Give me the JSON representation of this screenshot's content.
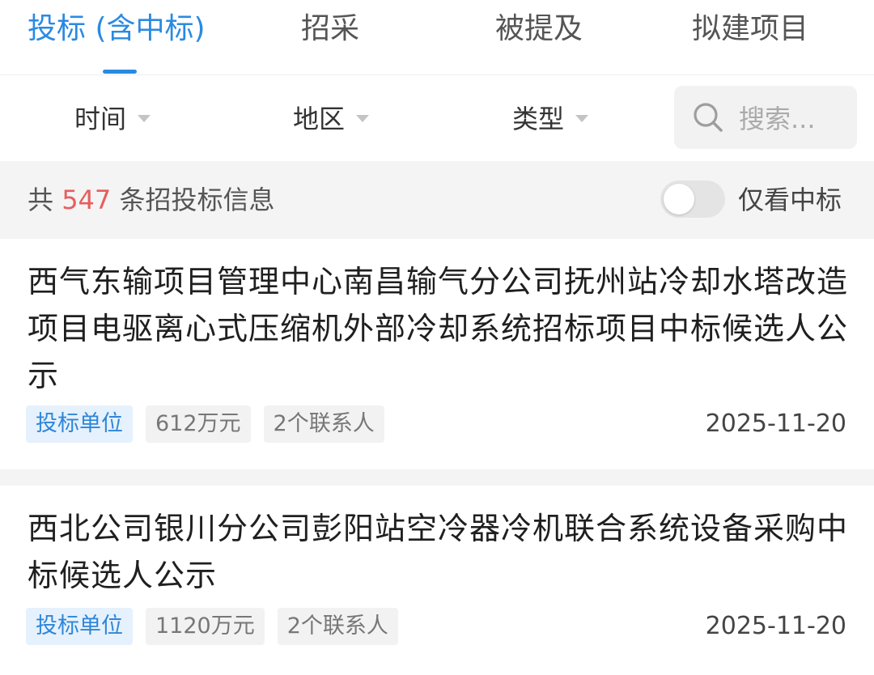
{
  "tabs": [
    {
      "label": "投标 (含中标)",
      "active": true
    },
    {
      "label": "招采",
      "active": false
    },
    {
      "label": "被提及",
      "active": false
    },
    {
      "label": "拟建项目",
      "active": false
    }
  ],
  "filters": {
    "time": "时间",
    "region": "地区",
    "type": "类型",
    "search_placeholder": "搜索..."
  },
  "summary": {
    "prefix": "共",
    "count": "547",
    "suffix": "条招投标信息",
    "toggle_label": "仅看中标",
    "toggle_on": false
  },
  "items": [
    {
      "title": "西气东输项目管理中心南昌输气分公司抚州站冷却水塔改造项目电驱离心式压缩机外部冷却系统招标项目中标候选人公示",
      "tag_role": "投标单位",
      "amount": "612万元",
      "contacts": "2个联系人",
      "date": "2025-11-20"
    },
    {
      "title": "西北公司银川分公司彭阳站空冷器冷机联合系统设备采购中标候选人公示",
      "tag_role": "投标单位",
      "amount": "1120万元",
      "contacts": "2个联系人",
      "date": "2025-11-20"
    }
  ],
  "colors": {
    "accent": "#2a8ae2",
    "count_red": "#e85d5d",
    "tag_blue_bg": "#e5f1fc",
    "tag_gray_bg": "#f2f2f2"
  }
}
